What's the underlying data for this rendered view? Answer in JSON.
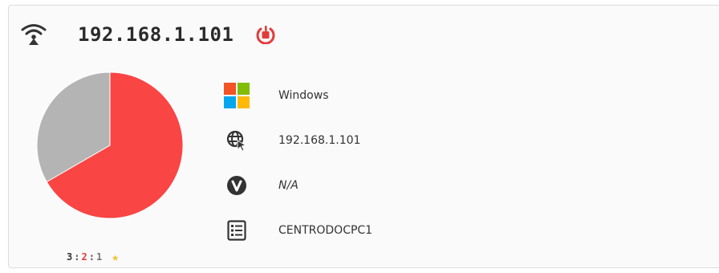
{
  "header": {
    "title": "192.168.1.101",
    "icons": {
      "network": "wifi-signal-icon",
      "action": "power-off-icon"
    },
    "action_color": "#e33b3b"
  },
  "details": {
    "os": {
      "icon": "windows-logo-icon",
      "value": "Windows"
    },
    "ip": {
      "icon": "globe-cursor-icon",
      "value": "192.168.1.101"
    },
    "version": {
      "icon": "version-v-icon",
      "value": "N/A"
    },
    "hostname": {
      "icon": "list-document-icon",
      "value": "CENTRODOCPC1"
    }
  },
  "counts": {
    "total": "3",
    "red": "2",
    "gray": "1",
    "star_icon": "star-icon"
  },
  "chart_data": {
    "type": "pie",
    "values": [
      2,
      1
    ],
    "colors": [
      "#fa4545",
      "#b4b4b4"
    ]
  },
  "colors": {
    "accent_red": "#fa4545",
    "neutral_gray": "#b4b4b4",
    "star": "#f4c430"
  }
}
